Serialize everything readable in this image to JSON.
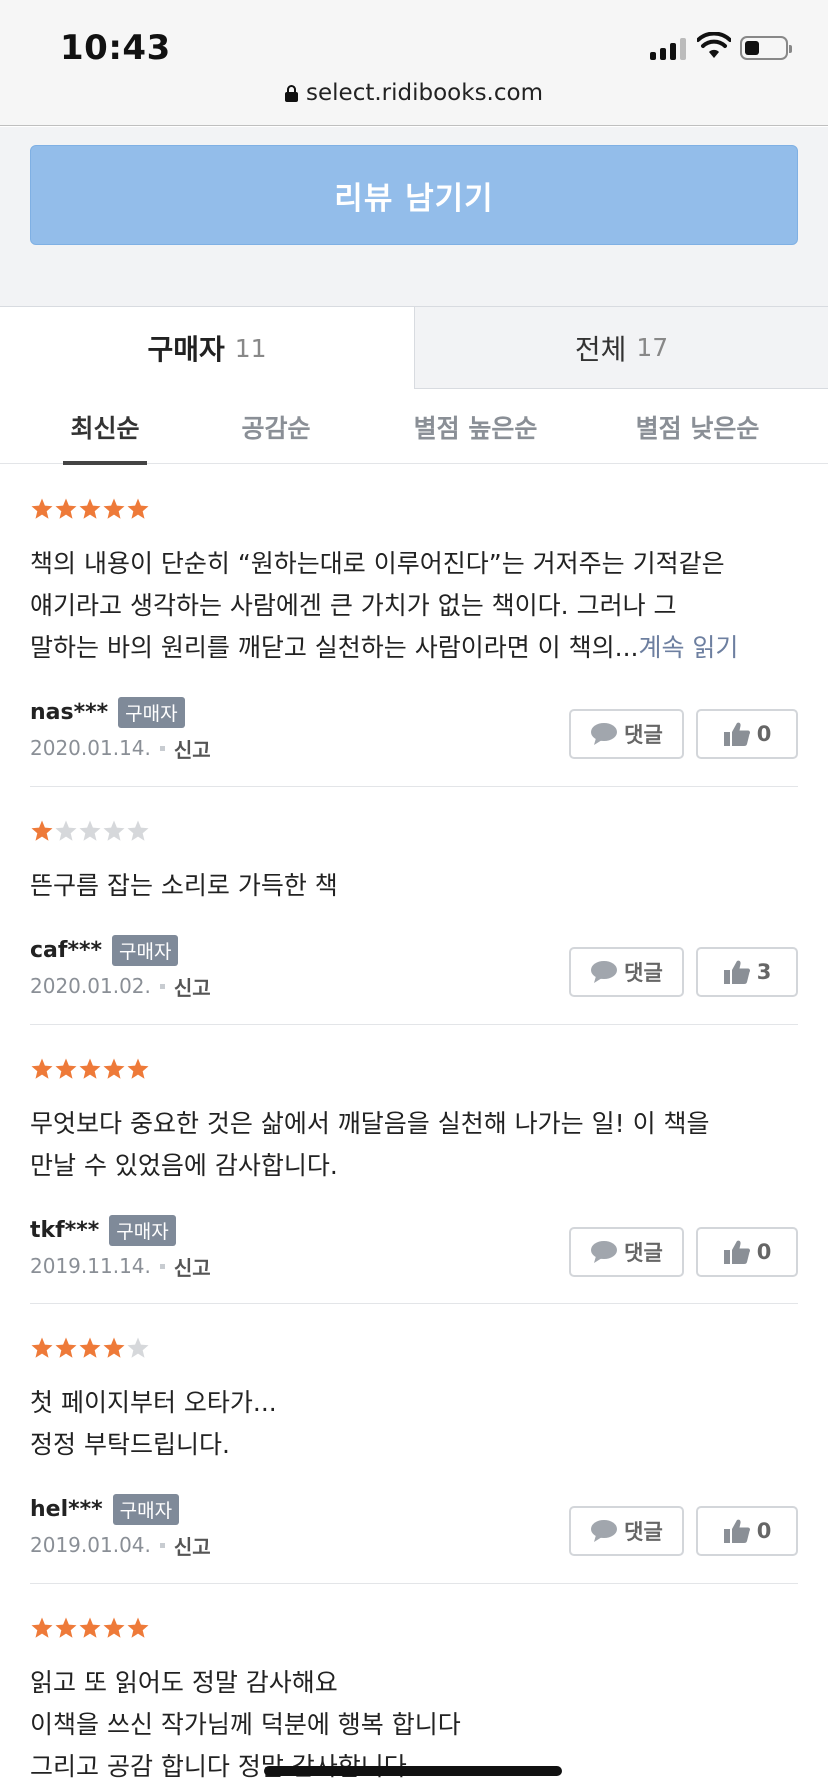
{
  "status": {
    "time": "10:43",
    "url": "select.ridibooks.com"
  },
  "review_button": {
    "label": "리뷰 남기기"
  },
  "tabs": [
    {
      "label": "구매자",
      "count": "11"
    },
    {
      "label": "전체",
      "count": "17"
    }
  ],
  "sort": [
    "최신순",
    "공감순",
    "별점 높은순",
    "별점 낮은순"
  ],
  "colors": {
    "star_on": "#ee7a39",
    "star_off": "#d6d8db",
    "button_blue": "#93bdea",
    "badge": "#7f8a99"
  },
  "reviews": [
    {
      "rating": 5,
      "lines": [
        "책의 내용이 단순히 “원하는대로 이루어진다”는 거저주는 기적같은",
        "얘기라고 생각하는 사람에겐 큰 가치가 없는 책이다. 그러나 그",
        "말하는 바의 원리를 깨닫고 실천하는 사람이라면 이 책의..."
      ],
      "more": "계속 읽기",
      "user": "nas***",
      "badge": "구매자",
      "date": "2020.01.14.",
      "report": "신고",
      "comment": "댓글",
      "likes": "0"
    },
    {
      "rating": 1,
      "lines": [
        "뜬구름 잡는 소리로 가득한 책"
      ],
      "more": "",
      "user": "caf***",
      "badge": "구매자",
      "date": "2020.01.02.",
      "report": "신고",
      "comment": "댓글",
      "likes": "3"
    },
    {
      "rating": 5,
      "lines": [
        "무엇보다 중요한 것은 삶에서 깨달음을 실천해 나가는 일! 이 책을",
        "만날 수 있었음에 감사합니다."
      ],
      "more": "",
      "user": "tkf***",
      "badge": "구매자",
      "date": "2019.11.14.",
      "report": "신고",
      "comment": "댓글",
      "likes": "0"
    },
    {
      "rating": 4,
      "lines": [
        "첫 페이지부터 오타가...",
        "정정 부탁드립니다."
      ],
      "more": "",
      "user": "hel***",
      "badge": "구매자",
      "date": "2019.01.04.",
      "report": "신고",
      "comment": "댓글",
      "likes": "0"
    },
    {
      "rating": 5,
      "lines": [
        "읽고 또 읽어도 정말 감사해요",
        "이책을 쓰신 작가님께 덕분에 행복 합니다",
        "그리고 공감 합니다 정말 감사합니다"
      ],
      "more": ""
    }
  ]
}
